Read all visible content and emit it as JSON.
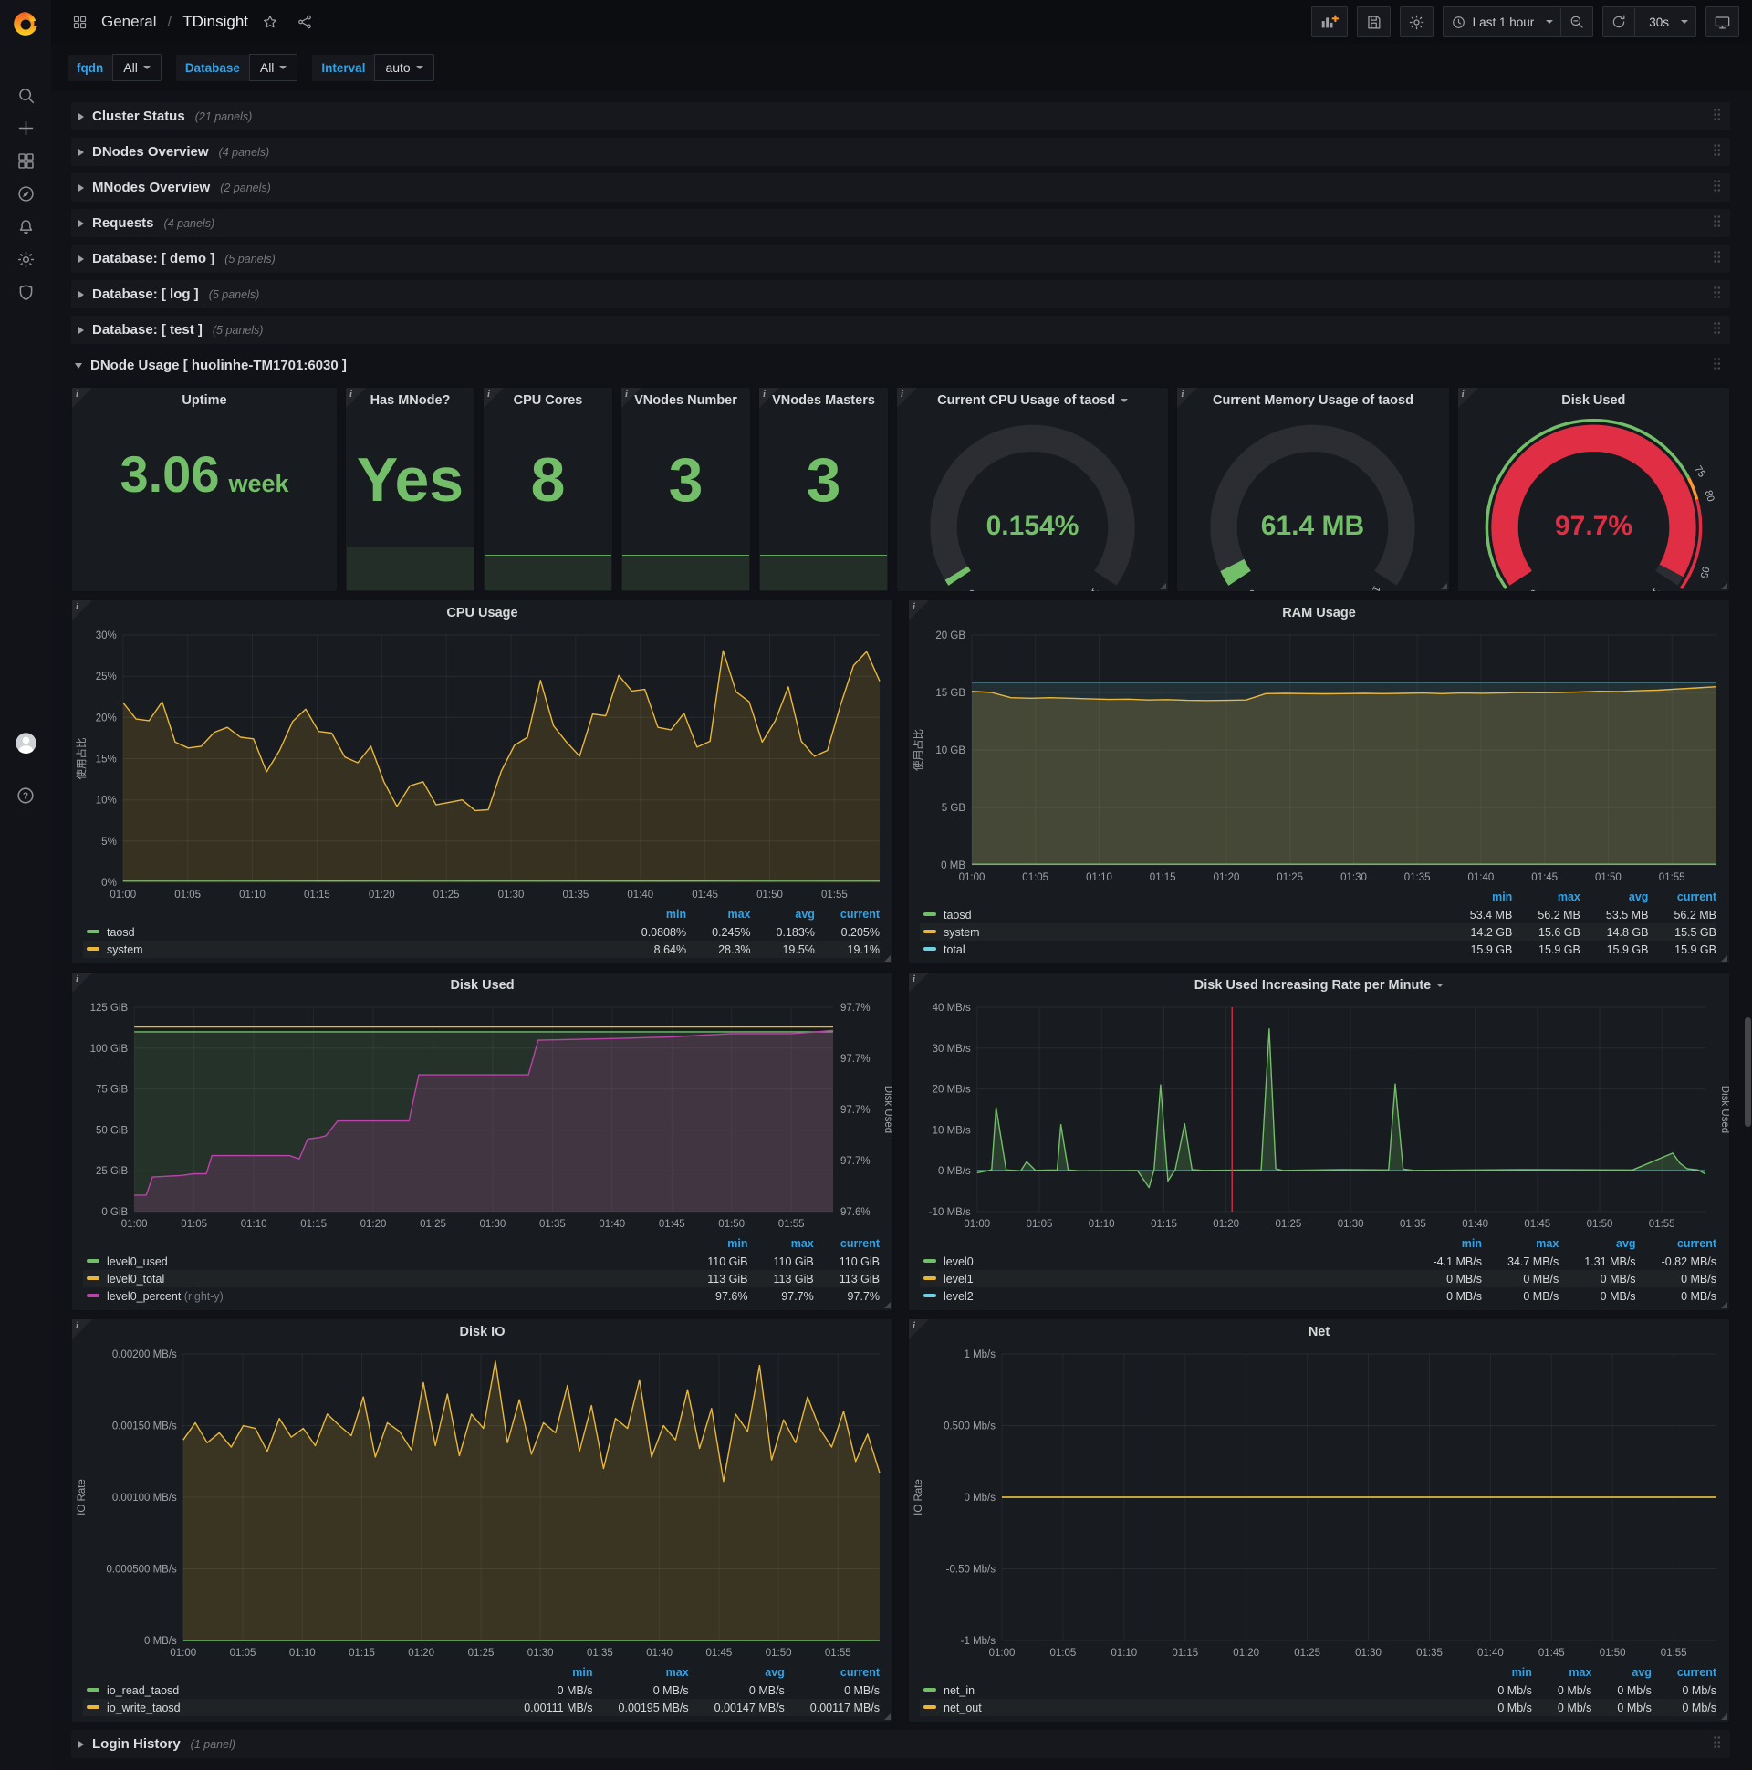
{
  "navbar": {
    "section": "General",
    "separator": "/",
    "title": "TDinsight",
    "time_range": "Last 1 hour",
    "refresh": "30s"
  },
  "variables": [
    {
      "label": "fqdn",
      "value": "All"
    },
    {
      "label": "Database",
      "value": "All"
    },
    {
      "label": "Interval",
      "value": "auto"
    }
  ],
  "rows": [
    {
      "title": "Cluster Status",
      "count": "(21 panels)"
    },
    {
      "title": "DNodes Overview",
      "count": "(4 panels)"
    },
    {
      "title": "MNodes Overview",
      "count": "(2 panels)"
    },
    {
      "title": "Requests",
      "count": "(4 panels)"
    },
    {
      "title": "Database: [ demo ]",
      "count": "(5 panels)"
    },
    {
      "title": "Database: [ log ]",
      "count": "(5 panels)"
    },
    {
      "title": "Database: [ test ]",
      "count": "(5 panels)"
    }
  ],
  "expanded_row": {
    "title": "DNode Usage [ huolinhe-TM1701:6030 ]"
  },
  "login_row": {
    "title": "Login History",
    "count": "(1 panel)"
  },
  "colors": {
    "green": "#73bf69",
    "yellow": "#eab839",
    "cyan": "#6ed0e0",
    "purple": "#ba43a9",
    "red": "#e02f44",
    "blue": "#33a2e5",
    "orange": "#ff9830"
  },
  "stats": [
    {
      "title": "Uptime",
      "value": "3.06",
      "unit": "week",
      "spark": 0
    },
    {
      "title": "Has MNode?",
      "value": "Yes",
      "spark": 0.21
    },
    {
      "title": "CPU Cores",
      "value": "8",
      "spark": 0.17
    },
    {
      "title": "VNodes Number",
      "value": "3",
      "spark": 0.17
    },
    {
      "title": "VNodes Masters",
      "value": "3",
      "spark": 0.17
    }
  ],
  "gauges": [
    {
      "title": "Current CPU Usage of taosd",
      "caret": true,
      "value": "0.154%",
      "min": "0",
      "max": "100",
      "pct": 0.0154,
      "type": "simple"
    },
    {
      "title": "Current Memory Usage of taosd",
      "caret": false,
      "value": "61.4 MB",
      "min": "0",
      "max": "1589",
      "pct": 0.0386,
      "type": "simple"
    },
    {
      "title": "Disk Used",
      "caret": false,
      "value": "97.7%",
      "min": "0",
      "max": "100",
      "pct": 0.977,
      "type": "threshold",
      "thresholds": [
        {
          "label": "75",
          "at": 0.75
        },
        {
          "label": "80",
          "at": 0.8
        },
        {
          "label": "95",
          "at": 0.95
        }
      ]
    }
  ],
  "xticks": [
    "01:00",
    "01:05",
    "01:10",
    "01:15",
    "01:20",
    "01:25",
    "01:30",
    "01:35",
    "01:40",
    "01:45",
    "01:50",
    "01:55"
  ],
  "charts": [
    {
      "id": "cpu",
      "title": "CPU Usage",
      "caret": false,
      "ylabel": "使用占比",
      "ylim": [
        0,
        30
      ],
      "yticks": [
        "0%",
        "5%",
        "10%",
        "15%",
        "20%",
        "25%",
        "30%"
      ],
      "series": [
        {
          "name": "system",
          "color": "#eab839",
          "fill": 0.15,
          "vals": [
            21.8,
            19.8,
            19.6,
            21.9,
            17.0,
            16.3,
            16.5,
            18.2,
            18.8,
            17.6,
            17.4,
            13.4,
            16.0,
            19.5,
            21.0,
            18.3,
            18.1,
            15.2,
            14.5,
            16.5,
            12.2,
            9.2,
            11.7,
            12.2,
            9.4,
            9.7,
            10.0,
            8.7,
            8.8,
            13.5,
            16.6,
            17.6,
            24.5,
            19.0,
            17.0,
            15.3,
            20.4,
            20.2,
            25.1,
            23.2,
            23.4,
            18.8,
            18.5,
            20.5,
            16.4,
            17.1,
            28.1,
            23.1,
            21.9,
            17.0,
            19.6,
            23.7,
            17.1,
            15.3,
            16.0,
            21.5,
            26.3,
            28.0,
            24.4
          ]
        },
        {
          "name": "taosd",
          "color": "#73bf69",
          "fill": 0.3,
          "vals": [
            0.2,
            0.22,
            0.19,
            0.21,
            0.2,
            0.18,
            0.22,
            0.2
          ]
        }
      ],
      "legend": {
        "cols": [
          "min",
          "max",
          "avg",
          "current"
        ],
        "rows": [
          {
            "name": "taosd",
            "color": "#73bf69",
            "values": [
              "0.0808%",
              "0.245%",
              "0.183%",
              "0.205%"
            ]
          },
          {
            "name": "system",
            "color": "#eab839",
            "values": [
              "8.64%",
              "28.3%",
              "19.5%",
              "19.1%"
            ]
          }
        ]
      }
    },
    {
      "id": "ram",
      "title": "RAM Usage",
      "caret": false,
      "ylabel": "使用占比",
      "ylim": [
        0,
        20
      ],
      "yticks": [
        "0 MB",
        "5 GB",
        "10 GB",
        "15 GB",
        "20 GB"
      ],
      "series": [
        {
          "name": "total",
          "color": "#6ed0e0",
          "fill": 0.12,
          "vals": [
            15.9,
            15.9
          ]
        },
        {
          "name": "system",
          "color": "#eab839",
          "fill": 0.18,
          "vals": [
            15.1,
            15.0,
            14.55,
            14.5,
            14.55,
            14.5,
            14.45,
            14.4,
            14.42,
            14.35,
            14.38,
            14.32,
            14.3,
            14.32,
            14.35,
            14.9,
            14.92,
            14.9,
            14.88,
            14.9,
            14.92,
            14.9,
            14.92,
            14.95,
            14.9,
            14.95,
            14.93,
            14.95,
            15.0,
            14.98,
            15.0,
            15.05,
            15.1,
            15.08,
            15.15,
            15.2,
            15.3,
            15.4,
            15.5
          ]
        },
        {
          "name": "taosd",
          "color": "#73bf69",
          "fill": 0,
          "vals": [
            0.06,
            0.06
          ]
        }
      ],
      "legend": {
        "cols": [
          "min",
          "max",
          "avg",
          "current"
        ],
        "rows": [
          {
            "name": "taosd",
            "color": "#73bf69",
            "values": [
              "53.4 MB",
              "56.2 MB",
              "53.5 MB",
              "56.2 MB"
            ]
          },
          {
            "name": "system",
            "color": "#eab839",
            "values": [
              "14.2 GB",
              "15.6 GB",
              "14.8 GB",
              "15.5 GB"
            ]
          },
          {
            "name": "total",
            "color": "#6ed0e0",
            "values": [
              "15.9 GB",
              "15.9 GB",
              "15.9 GB",
              "15.9 GB"
            ]
          }
        ]
      }
    },
    {
      "id": "disk",
      "title": "Disk Used",
      "caret": false,
      "ylim": [
        0,
        125
      ],
      "yticks": [
        "0 GiB",
        "25 GiB",
        "50 GiB",
        "75 GiB",
        "100 GiB",
        "125 GiB"
      ],
      "rticks": [
        "97.6%",
        "97.7%",
        "97.7%",
        "97.7%",
        "97.7%"
      ],
      "rlabel": "Disk Used",
      "rlim": [
        97.588,
        97.712
      ],
      "series": [
        {
          "name": "level0_used",
          "color": "#73bf69",
          "fill": 0.14,
          "vals": [
            110,
            110
          ]
        },
        {
          "name": "level0_percent",
          "color": "#ba43a9",
          "fill": 0.2,
          "axis": "right",
          "x": [
            0,
            0.017,
            0.026,
            0.068,
            0.085,
            0.103,
            0.111,
            0.222,
            0.236,
            0.248,
            0.265,
            0.274,
            0.291,
            0.393,
            0.407,
            0.564,
            0.578,
            0.684,
            0.769,
            0.855,
            0.94,
            0.974,
            1
          ],
          "vals": [
            97.598,
            97.598,
            97.609,
            97.61,
            97.611,
            97.611,
            97.622,
            97.622,
            97.62,
            97.632,
            97.633,
            97.634,
            97.643,
            97.643,
            97.671,
            97.671,
            97.692,
            97.693,
            97.694,
            97.696,
            97.696,
            97.697,
            97.698
          ]
        },
        {
          "name": "level0_total",
          "color": "#eab839",
          "fill": 0,
          "vals": [
            113,
            113
          ]
        }
      ],
      "legend": {
        "cols": [
          "min",
          "max",
          "current"
        ],
        "rows": [
          {
            "name": "level0_used",
            "color": "#73bf69",
            "values": [
              "110 GiB",
              "110 GiB",
              "110 GiB"
            ]
          },
          {
            "name": "level0_total",
            "color": "#eab839",
            "values": [
              "113 GiB",
              "113 GiB",
              "113 GiB"
            ]
          },
          {
            "name": "level0_percent",
            "suffix": "(right-y)",
            "color": "#ba43a9",
            "values": [
              "97.6%",
              "97.7%",
              "97.7%"
            ]
          }
        ]
      }
    },
    {
      "id": "rate",
      "title": "Disk Used Increasing Rate per Minute",
      "caret": true,
      "ylim": [
        -10,
        40
      ],
      "yticks": [
        "-10 MB/s",
        "0 MB/s",
        "10 MB/s",
        "20 MB/s",
        "30 MB/s",
        "40 MB/s"
      ],
      "rlabel": "Disk Used",
      "annotation": 0.35,
      "series": [
        {
          "name": "level1",
          "color": "#eab839",
          "fill": 0,
          "vals": [
            0,
            0
          ]
        },
        {
          "name": "level2",
          "color": "#6ed0e0",
          "fill": 0,
          "vals": [
            0,
            0
          ]
        },
        {
          "name": "level0",
          "color": "#73bf69",
          "fill": 0.22,
          "x": [
            0,
            0.015,
            0.02,
            0.026,
            0.04,
            0.06,
            0.068,
            0.08,
            0.11,
            0.115,
            0.125,
            0.14,
            0.22,
            0.236,
            0.243,
            0.252,
            0.262,
            0.272,
            0.285,
            0.295,
            0.31,
            0.39,
            0.401,
            0.41,
            0.42,
            0.5,
            0.565,
            0.574,
            0.585,
            0.6,
            0.75,
            0.9,
            0.955,
            0.965,
            0.975,
            0.99,
            1
          ],
          "vals": [
            -0.5,
            0,
            0.3,
            15.5,
            0.2,
            0,
            2.2,
            0.1,
            0.2,
            11.3,
            0.2,
            0,
            0.1,
            -4.1,
            0.3,
            21,
            -2.5,
            0.2,
            11.5,
            0.3,
            0.1,
            0.2,
            34.7,
            0.5,
            0.1,
            0.3,
            0.2,
            21.2,
            0.4,
            0.1,
            0.3,
            0.2,
            4.3,
            1.8,
            0.5,
            0.2,
            -0.82
          ]
        }
      ],
      "legend": {
        "cols": [
          "min",
          "max",
          "avg",
          "current"
        ],
        "rows": [
          {
            "name": "level0",
            "color": "#73bf69",
            "values": [
              "-4.1 MB/s",
              "34.7 MB/s",
              "1.31 MB/s",
              "-0.82 MB/s"
            ]
          },
          {
            "name": "level1",
            "color": "#eab839",
            "values": [
              "0 MB/s",
              "0 MB/s",
              "0 MB/s",
              "0 MB/s"
            ]
          },
          {
            "name": "level2",
            "color": "#6ed0e0",
            "values": [
              "0 MB/s",
              "0 MB/s",
              "0 MB/s",
              "0 MB/s"
            ]
          }
        ]
      }
    },
    {
      "id": "io",
      "title": "Disk IO",
      "caret": false,
      "ylabel": "IO Rate",
      "ylim": [
        0,
        0.002
      ],
      "yticks": [
        "0 MB/s",
        "0.000500 MB/s",
        "0.00100 MB/s",
        "0.00150 MB/s",
        "0.00200 MB/s"
      ],
      "series": [
        {
          "name": "io_write_taosd",
          "color": "#eab839",
          "fill": 0.16,
          "vals": [
            0.0014,
            0.00152,
            0.00138,
            0.00145,
            0.00135,
            0.0015,
            0.00148,
            0.00132,
            0.00155,
            0.00142,
            0.00148,
            0.00136,
            0.00158,
            0.0015,
            0.00143,
            0.0017,
            0.00128,
            0.00152,
            0.00146,
            0.00133,
            0.0018,
            0.00136,
            0.00172,
            0.00129,
            0.00158,
            0.00148,
            0.00195,
            0.00138,
            0.00168,
            0.0013,
            0.00152,
            0.00145,
            0.00178,
            0.00132,
            0.00164,
            0.0012,
            0.00155,
            0.00148,
            0.00182,
            0.00128,
            0.0015,
            0.0014,
            0.00175,
            0.00134,
            0.00162,
            0.00111,
            0.00158,
            0.00146,
            0.00192,
            0.00126,
            0.00154,
            0.00138,
            0.0017,
            0.00148,
            0.00135,
            0.0016,
            0.00125,
            0.00144,
            0.00117
          ]
        },
        {
          "name": "io_read_taosd",
          "color": "#73bf69",
          "fill": 0,
          "vals": [
            0,
            0
          ]
        }
      ],
      "legend": {
        "cols": [
          "min",
          "max",
          "avg",
          "current"
        ],
        "rows": [
          {
            "name": "io_read_taosd",
            "color": "#73bf69",
            "values": [
              "0 MB/s",
              "0 MB/s",
              "0 MB/s",
              "0 MB/s"
            ]
          },
          {
            "name": "io_write_taosd",
            "color": "#eab839",
            "values": [
              "0.00111 MB/s",
              "0.00195 MB/s",
              "0.00147 MB/s",
              "0.00117 MB/s"
            ]
          }
        ]
      }
    },
    {
      "id": "net",
      "title": "Net",
      "caret": false,
      "ylabel": "IO Rate",
      "ylim": [
        -1,
        1
      ],
      "yticks": [
        "-1 Mb/s",
        "-0.50 Mb/s",
        "0 Mb/s",
        "0.500 Mb/s",
        "1 Mb/s"
      ],
      "series": [
        {
          "name": "net_in",
          "color": "#73bf69",
          "fill": 0,
          "vals": [
            0,
            0
          ]
        },
        {
          "name": "net_out",
          "color": "#eab839",
          "fill": 0,
          "vals": [
            0,
            0
          ]
        }
      ],
      "legend": {
        "cols": [
          "min",
          "max",
          "avg",
          "current"
        ],
        "rows": [
          {
            "name": "net_in",
            "color": "#73bf69",
            "values": [
              "0 Mb/s",
              "0 Mb/s",
              "0 Mb/s",
              "0 Mb/s"
            ]
          },
          {
            "name": "net_out",
            "color": "#eab839",
            "values": [
              "0 Mb/s",
              "0 Mb/s",
              "0 Mb/s",
              "0 Mb/s"
            ]
          }
        ]
      }
    }
  ]
}
